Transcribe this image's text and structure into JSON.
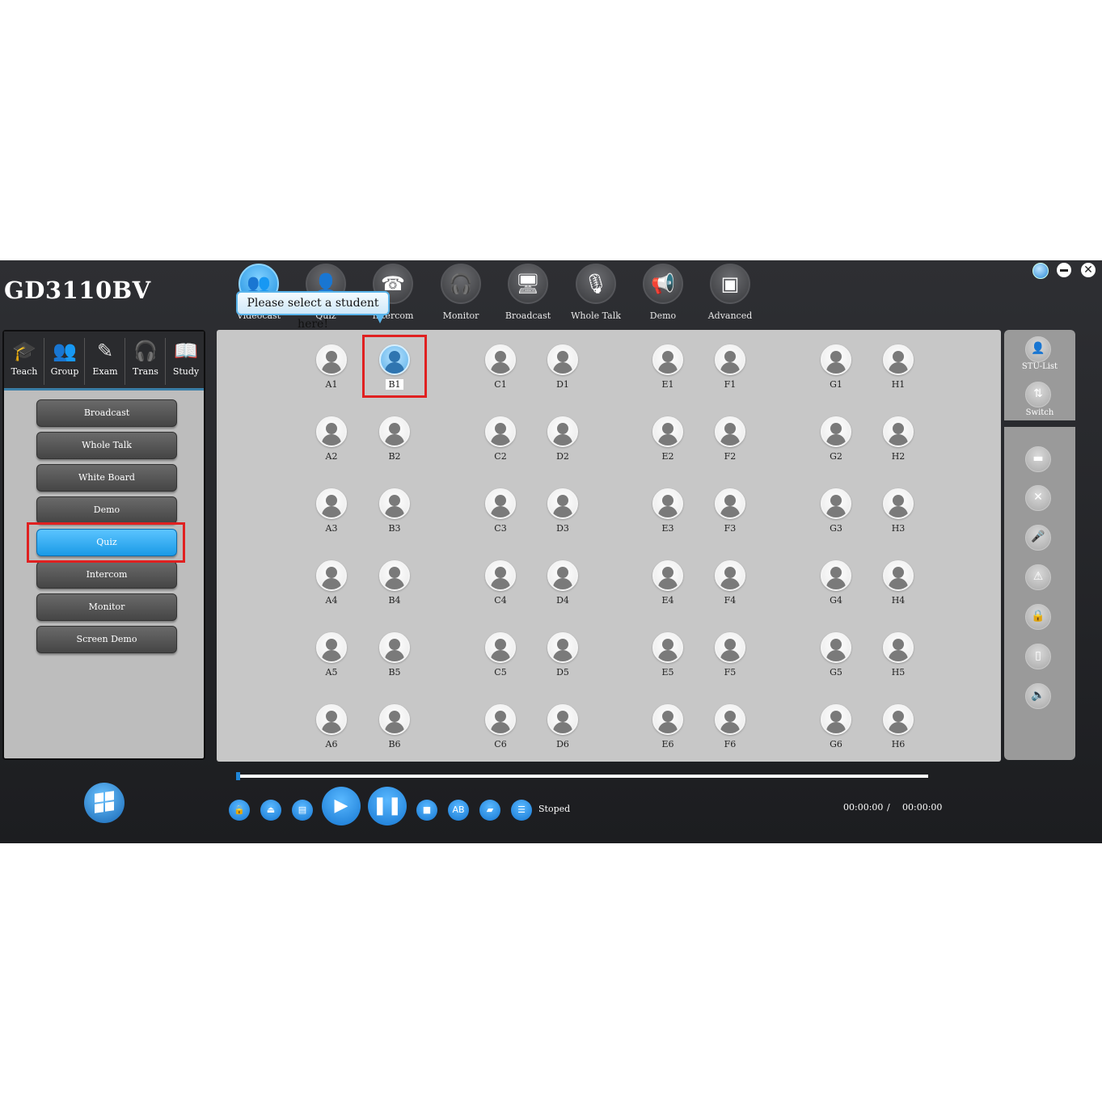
{
  "app": {
    "title": "GD3110BV",
    "window_controls": [
      "help-icon",
      "minimize-icon",
      "close-icon"
    ]
  },
  "toolbar": {
    "items": [
      {
        "label": "Videocast",
        "icon": "videocast-icon",
        "active": true
      },
      {
        "label": "Quiz",
        "icon": "quiz-icon"
      },
      {
        "label": "Intercom",
        "icon": "intercom-icon"
      },
      {
        "label": "Monitor",
        "icon": "headset-icon"
      },
      {
        "label": "Broadcast",
        "icon": "screen-icon"
      },
      {
        "label": "Whole Talk",
        "icon": "microphone-icon"
      },
      {
        "label": "Demo",
        "icon": "megaphone-icon"
      },
      {
        "label": "Advanced",
        "icon": "advanced-icon"
      }
    ]
  },
  "tooltip": {
    "text": "Please select a student here!"
  },
  "left_tabs": [
    {
      "label": "Teach",
      "icon": "teach-icon"
    },
    {
      "label": "Group",
      "icon": "group-icon"
    },
    {
      "label": "Exam",
      "icon": "exam-icon"
    },
    {
      "label": "Trans",
      "icon": "headphones-icon"
    },
    {
      "label": "Study",
      "icon": "book-icon"
    }
  ],
  "left_menu": [
    {
      "label": "Broadcast"
    },
    {
      "label": "Whole Talk"
    },
    {
      "label": "White Board"
    },
    {
      "label": "Demo"
    },
    {
      "label": "Quiz",
      "active": true
    },
    {
      "label": "Intercom"
    },
    {
      "label": "Monitor"
    },
    {
      "label": "Screen Demo"
    }
  ],
  "students": {
    "columns": [
      "A",
      "B",
      "C",
      "D",
      "E",
      "F",
      "G",
      "H"
    ],
    "rows": 6,
    "selected": "B1"
  },
  "right_panel": {
    "top": [
      {
        "label": "STU-List",
        "icon": "student-list-icon"
      },
      {
        "label": "Switch",
        "icon": "switch-icon"
      }
    ],
    "tools": [
      "message-icon",
      "close-icon",
      "microphone-icon",
      "warning-icon",
      "lock-icon",
      "unlock-icon",
      "volume-icon"
    ]
  },
  "player": {
    "progress": 0.0,
    "buttons": [
      "lock-icon",
      "eject-icon",
      "file-icon",
      "play-icon",
      "pause-icon",
      "stop-icon",
      "ab-repeat-icon",
      "folder-icon",
      "playlist-icon"
    ],
    "ab_label": "AB",
    "status": "Stoped",
    "time_current": "00:00:00",
    "time_separator": "/",
    "time_total": "00:00:00"
  },
  "colors": {
    "accent": "#1a9ae6",
    "highlight": "#e02020",
    "panel": "#c7c7c7"
  }
}
